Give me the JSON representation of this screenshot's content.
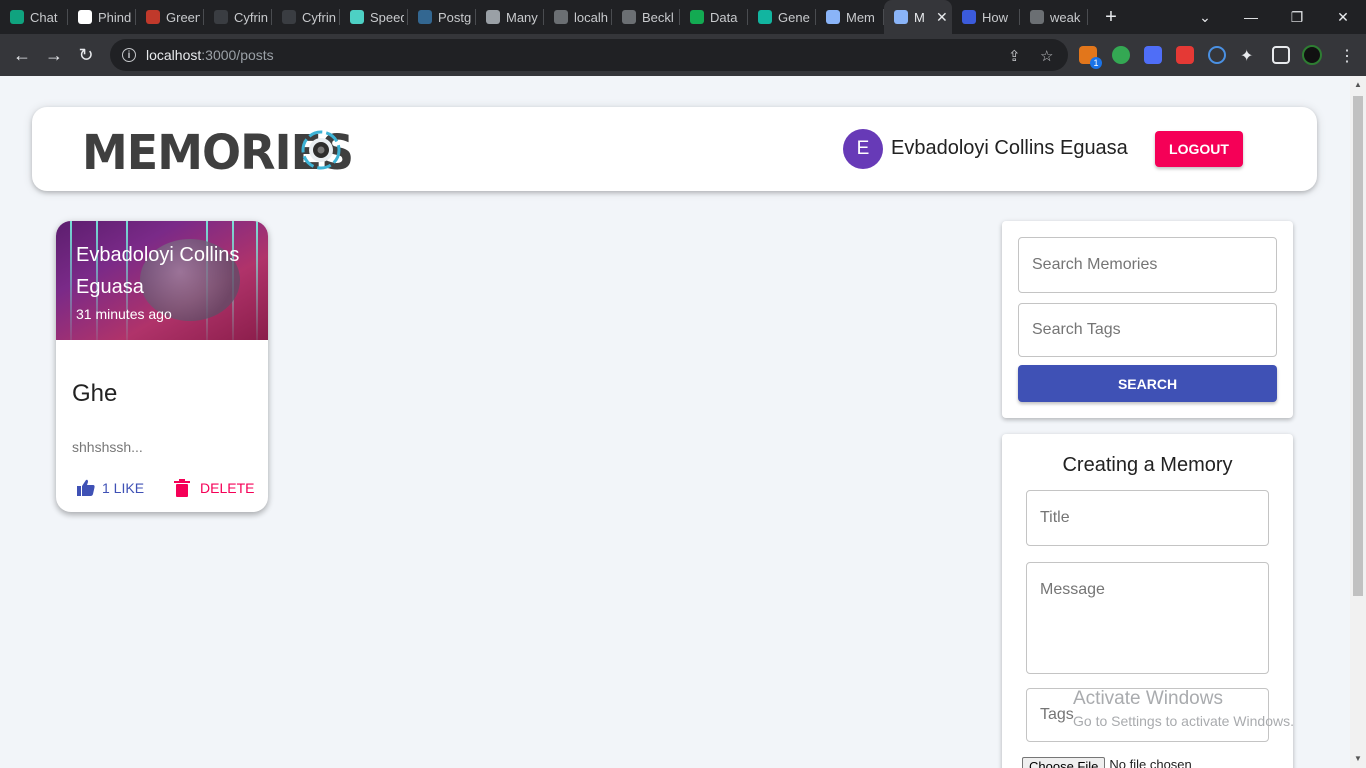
{
  "browser": {
    "tabs": [
      {
        "label": "Chat",
        "color": "#10a37f"
      },
      {
        "label": "Phind",
        "color": "#ffffff"
      },
      {
        "label": "Green",
        "color": "#c0392b"
      },
      {
        "label": "Cyfrin",
        "color": "#3a3d42"
      },
      {
        "label": "Cyfrin",
        "color": "#3a3d42"
      },
      {
        "label": "Speed",
        "color": "#4dd0c4"
      },
      {
        "label": "Postg",
        "color": "#336791"
      },
      {
        "label": "Many",
        "color": "#9aa0a6"
      },
      {
        "label": "localh",
        "color": "#6b6f73"
      },
      {
        "label": "Beckl",
        "color": "#6b6f73"
      },
      {
        "label": "Data",
        "color": "#13aa52"
      },
      {
        "label": "Gene",
        "color": "#12b5a0"
      },
      {
        "label": "Mem",
        "color": "#8ab4f8"
      },
      {
        "label": "M",
        "color": "#8ab4f8",
        "active": true
      },
      {
        "label": "How",
        "color": "#3b5bdb"
      },
      {
        "label": "weak",
        "color": "#6b6f73"
      }
    ],
    "url_host": "localhost",
    "url_path": ":3000/posts",
    "extension_badge": "1"
  },
  "app": {
    "brand": "MEMORIES",
    "user_initial": "E",
    "user_name": "Evbadoloyi Collins Eguasa",
    "logout_label": "LOGOUT"
  },
  "post": {
    "author": "Evbadoloyi Collins Eguasa",
    "time": "31 minutes ago",
    "title": "Ghe",
    "message": "shhshssh...",
    "like_label": "1 LIKE",
    "delete_label": "DELETE"
  },
  "search": {
    "memories_placeholder": "Search Memories",
    "tags_placeholder": "Search Tags",
    "button_label": "SEARCH"
  },
  "form": {
    "heading": "Creating a Memory",
    "title_placeholder": "Title",
    "message_placeholder": "Message",
    "tags_placeholder": "Tags",
    "file_button": "Choose File",
    "file_status": "No file chosen"
  },
  "watermark": {
    "line1": "Activate Windows",
    "line2": "Go to Settings to activate Windows."
  },
  "colors": {
    "primary": "#3f51b5",
    "secondary": "#f50057",
    "avatar": "#673ab7"
  }
}
